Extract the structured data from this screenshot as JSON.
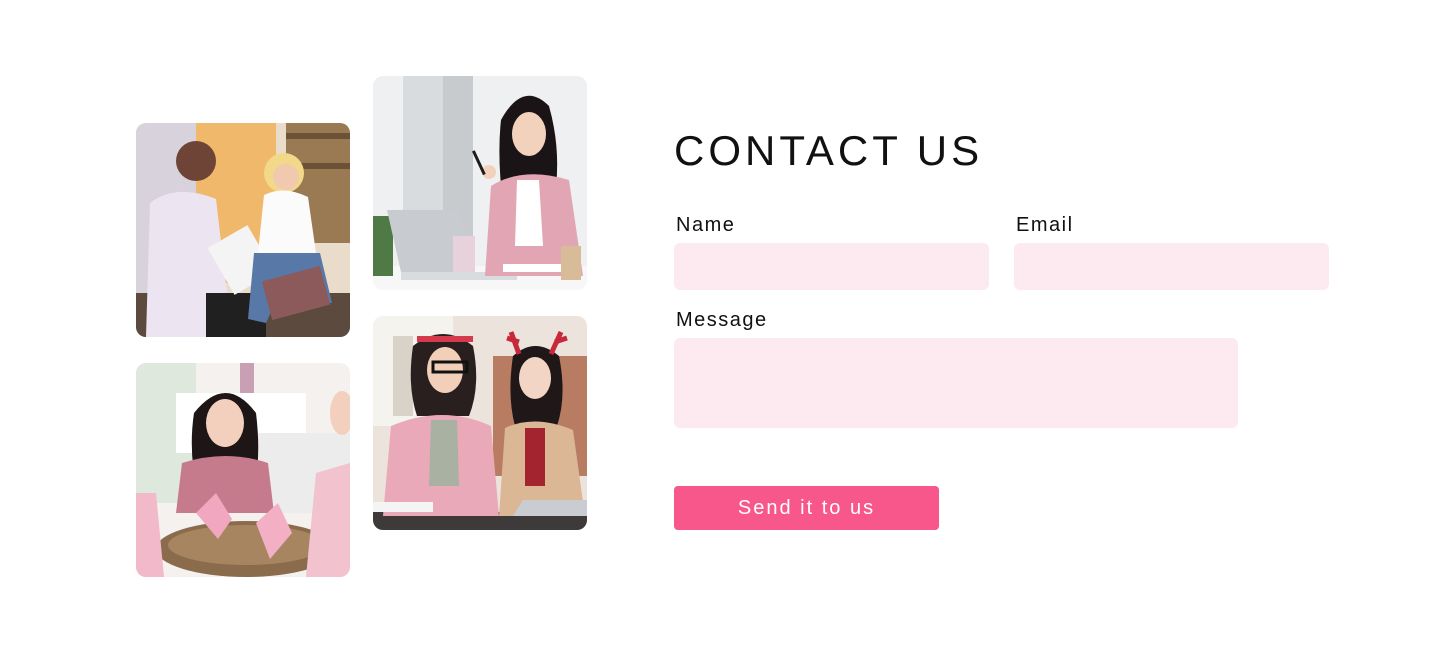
{
  "contact": {
    "title": "CONTACT US",
    "name_label": "Name",
    "email_label": "Email",
    "message_label": "Message",
    "name_value": "",
    "email_value": "",
    "message_value": "",
    "submit_label": "Send it to us"
  },
  "colors": {
    "field_background": "#fde9f0",
    "button_background": "#f7578a",
    "title_text": "#111111"
  },
  "photos": [
    {
      "subject": "therapy-session-photo"
    },
    {
      "subject": "woman-at-laptop-photo"
    },
    {
      "subject": "pink-ribbon-group-photo"
    },
    {
      "subject": "office-coworkers-photo"
    }
  ]
}
